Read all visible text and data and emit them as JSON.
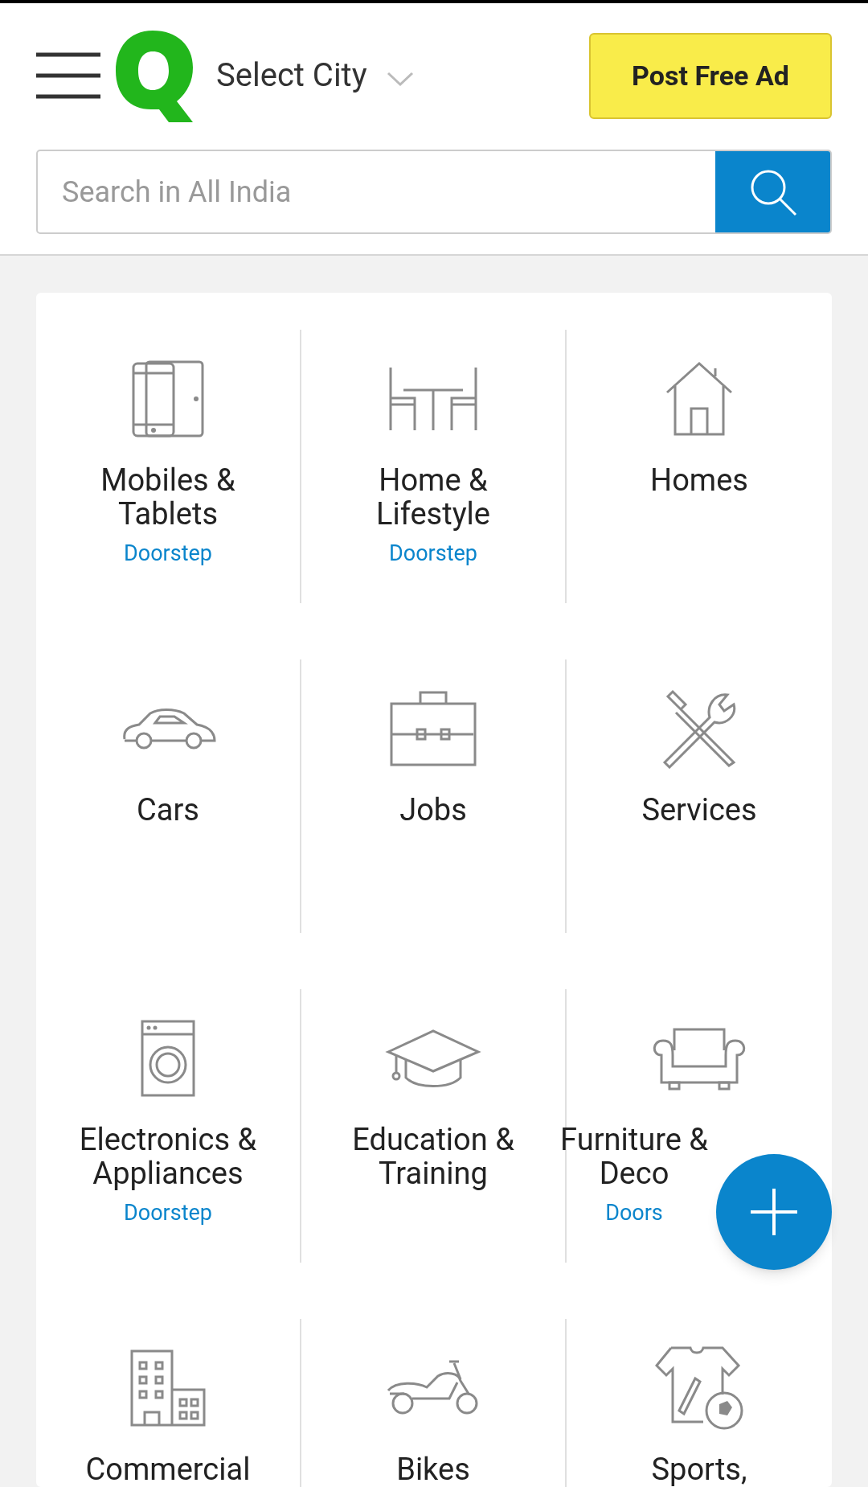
{
  "header": {
    "city": "Select City",
    "post_button": "Post Free Ad"
  },
  "search": {
    "placeholder": "Search in All India"
  },
  "categories": [
    {
      "title": "Mobiles & Tablets",
      "badge": "Doorstep"
    },
    {
      "title": "Home & Lifestyle",
      "badge": "Doorstep"
    },
    {
      "title": "Homes"
    },
    {
      "title": "Cars"
    },
    {
      "title": "Jobs"
    },
    {
      "title": "Services"
    },
    {
      "title": "Electronics & Appliances",
      "badge": "Doorstep"
    },
    {
      "title": "Education & Training"
    },
    {
      "title": "Furniture & Deco",
      "badge": "Doors"
    },
    {
      "title": "Commercial"
    },
    {
      "title": "Bikes"
    },
    {
      "title": "Sports,"
    }
  ]
}
